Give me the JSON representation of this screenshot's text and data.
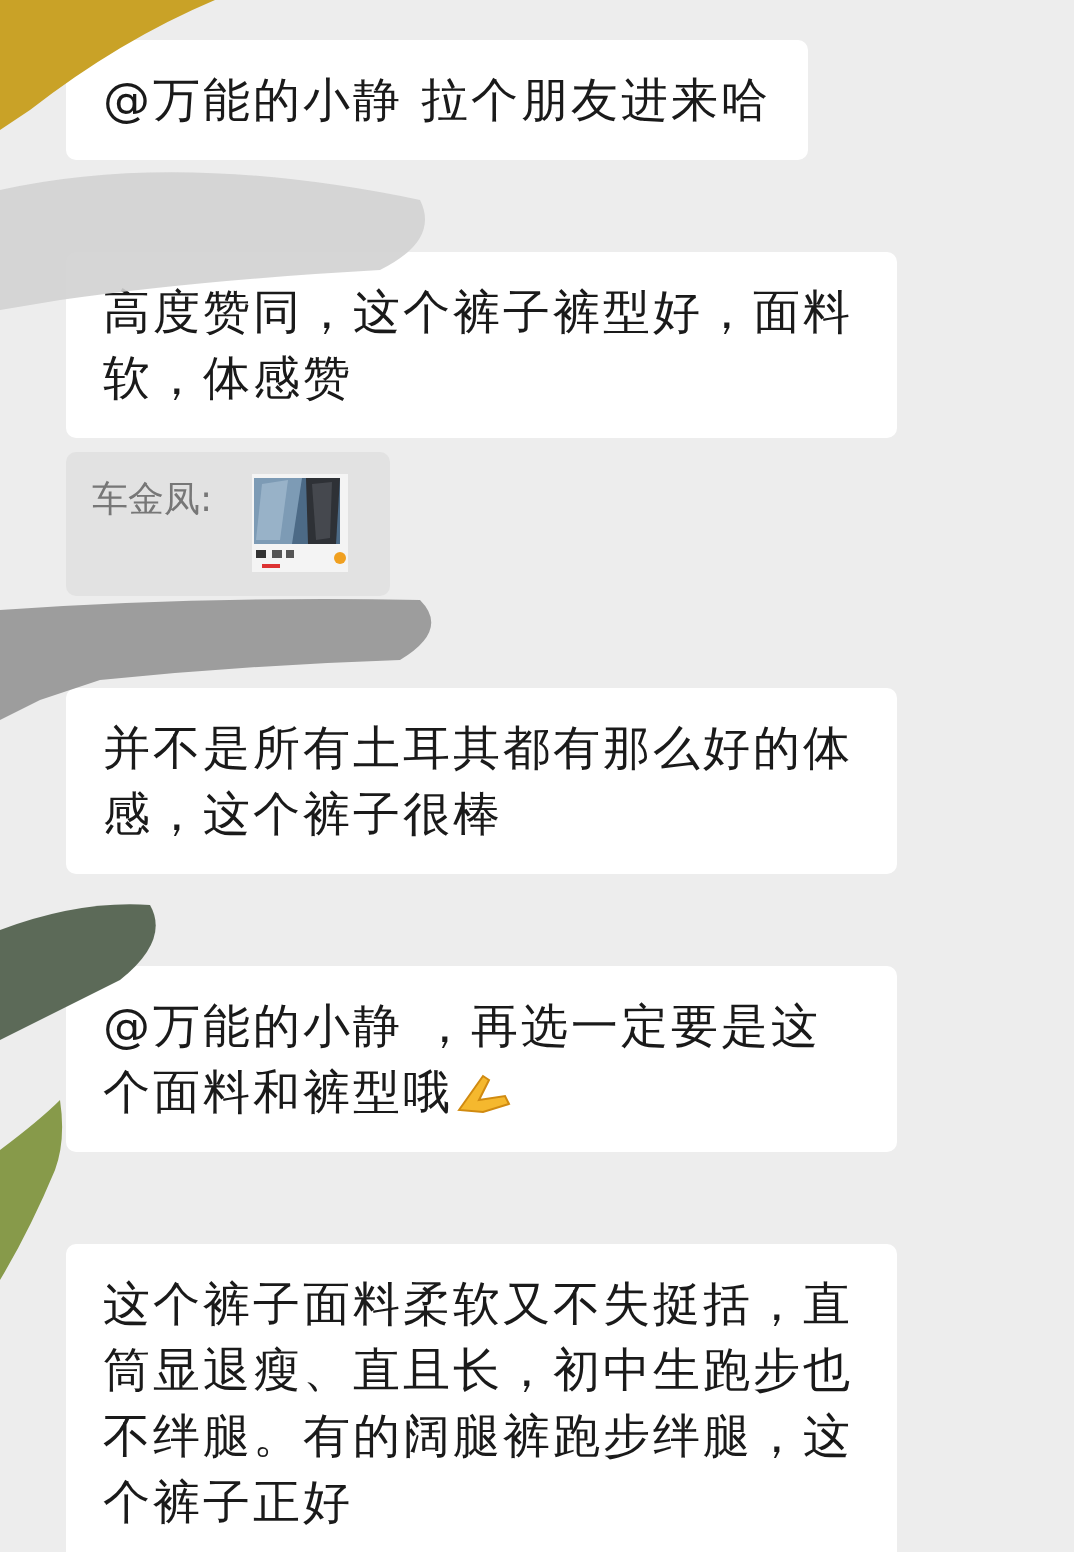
{
  "messages": [
    {
      "kind": "text",
      "text": "@万能的小静  拉个朋友进来哈"
    },
    {
      "kind": "text",
      "text": "高度赞同，这个裤子裤型好，面料软，体感赞"
    },
    {
      "kind": "quote",
      "author": "车金凤:"
    },
    {
      "kind": "text",
      "text": "并不是所有土耳其都有那么好的体感，这个裤子很棒"
    },
    {
      "kind": "text",
      "text": "@万能的小静 ，再选一定要是这个面料和裤型哦",
      "emoji": true
    },
    {
      "kind": "text",
      "text": "这个裤子面料柔软又不失挺括，直筒显退瘦、直且长，初中生跑步也不绊腿。有的阔腿裤跑步绊腿，这个裤子正好"
    }
  ]
}
